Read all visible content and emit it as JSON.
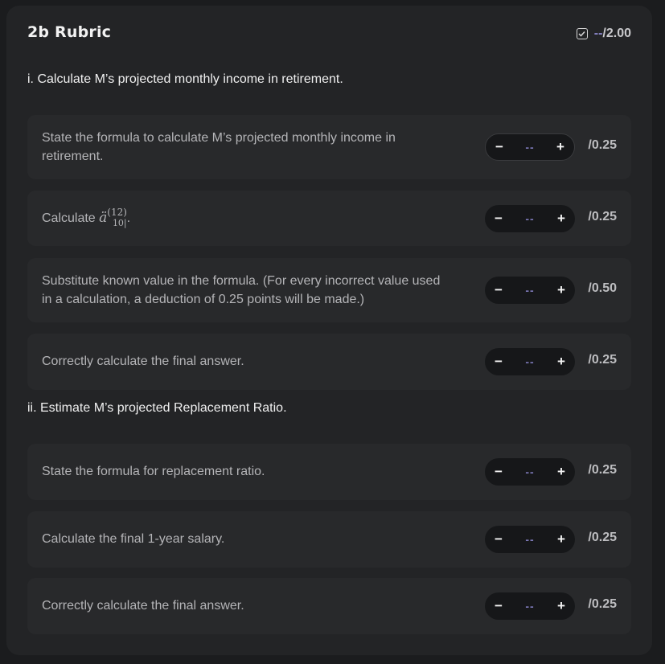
{
  "rubric": {
    "title": "2b Rubric",
    "total": {
      "dash": "--",
      "max": "/2.00"
    }
  },
  "sections": [
    {
      "title": "i. Calculate M’s projected monthly income in retirement.",
      "items": [
        {
          "text": "State the formula to calculate M’s projected monthly income in retirement.",
          "value": "--",
          "max": "/0.25"
        },
        {
          "text_prefix": "Calculate ",
          "math_base": "ä",
          "math_sup": "(12)",
          "math_sub": "10|",
          "text_suffix": ".",
          "value": "--",
          "max": "/0.25"
        },
        {
          "text": "Substitute known value in the formula. (For every incorrect value used in a calculation, a deduction of 0.25 points will be made.)",
          "value": "--",
          "max": "/0.50"
        },
        {
          "text": "Correctly calculate the final answer.",
          "value": "--",
          "max": "/0.25"
        }
      ]
    },
    {
      "title": "ii. Estimate M’s projected Replacement Ratio.",
      "items": [
        {
          "text": "State the formula for replacement ratio.",
          "value": "--",
          "max": "/0.25"
        },
        {
          "text": "Calculate the final 1-year salary.",
          "value": "--",
          "max": "/0.25"
        },
        {
          "text": "Correctly calculate the final answer.",
          "value": "--",
          "max": "/0.25"
        }
      ]
    }
  ],
  "stepper": {
    "minus": "−",
    "plus": "+"
  },
  "icons": {
    "total": "checkbox-icon",
    "decrement": "minus-icon",
    "increment": "plus-icon"
  },
  "colors": {
    "background": "#1b1c1e",
    "panel": "#232426",
    "row": "#28292b",
    "accent": "#7d79b8"
  }
}
